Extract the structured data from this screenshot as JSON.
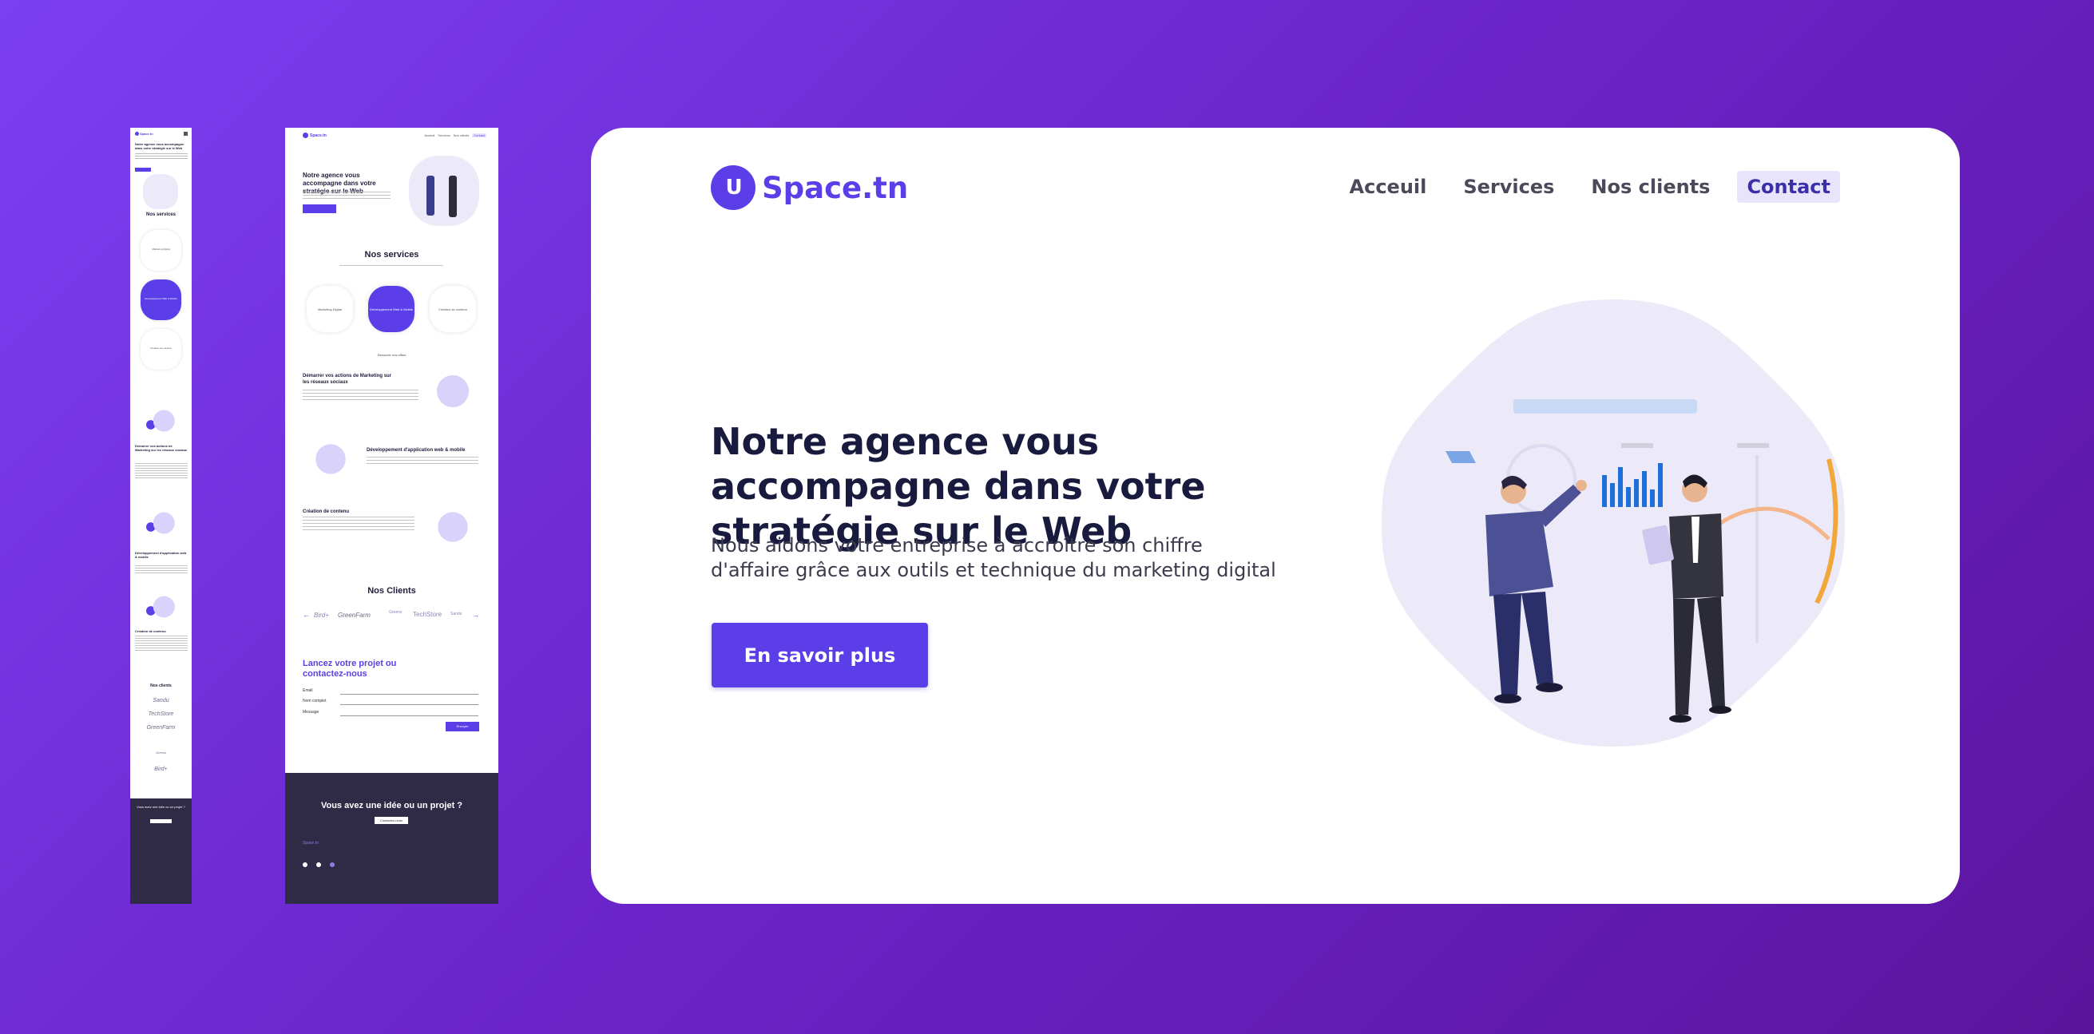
{
  "brand": {
    "mark": "U",
    "name": "Space.tn"
  },
  "nav": {
    "items": [
      "Acceuil",
      "Services",
      "Nos clients"
    ],
    "contact": "Contact"
  },
  "hero": {
    "title": "Notre agence vous accompagne dans votre stratégie sur le Web",
    "subtitle": "Nous aidons votre entreprise à accroître son chiffre d'affaire grâce aux outils et technique du marketing digital",
    "button": "En savoir plus"
  },
  "tablet": {
    "hero_title": "Notre agence vous accompagne dans votre stratégie sur le Web",
    "hero_button": "En savoir plus",
    "services_title": "Nos services",
    "services": [
      "Marketing Digital",
      "Développement Web & Mobile",
      "Création de contenu"
    ],
    "offers_link": "Découvrir nos offres",
    "feature1": "Démarrer vos actions de Marketing sur les réseaux sociaux",
    "feature2": "Développement d'application web & mobile",
    "feature3": "Création de contenu",
    "clients_title": "Nos Clients",
    "clients": [
      "Bird+",
      "GreenFarm",
      "Greens",
      "TechStore",
      "Sandu"
    ],
    "contact_title": "Lancez votre projet ou contactez-nous",
    "fields": [
      "Email",
      "Nom complet",
      "Message"
    ],
    "send": "Envoyer",
    "footer_question": "Vous avez une idée ou un projet ?",
    "footer_button": "Contactez-nous"
  },
  "mobile": {
    "hero_title": "Notre agence vous accompagne dans votre stratégie sur le Web",
    "services_title": "Nos services",
    "services": [
      "Marketing Digital",
      "Développement Web & Mobile",
      "Création de contenu"
    ],
    "feature1": "Démarrer vos actions de Marketing sur les réseaux sociaux",
    "feature2": "Développement d'application web & mobile",
    "feature3": "Création de contenu",
    "clients_title": "Nos clients",
    "clients": [
      "Sandu",
      "TechStore",
      "GreenFarm",
      "Greens",
      "Bird+"
    ],
    "footer_question": "Vous avez une idée ou un projet ?"
  },
  "colors": {
    "accent": "#5b3ee8",
    "background_start": "#7b3ff2",
    "background_end": "#5c149e",
    "dark": "#181a3e",
    "footer": "#2f2a46"
  }
}
